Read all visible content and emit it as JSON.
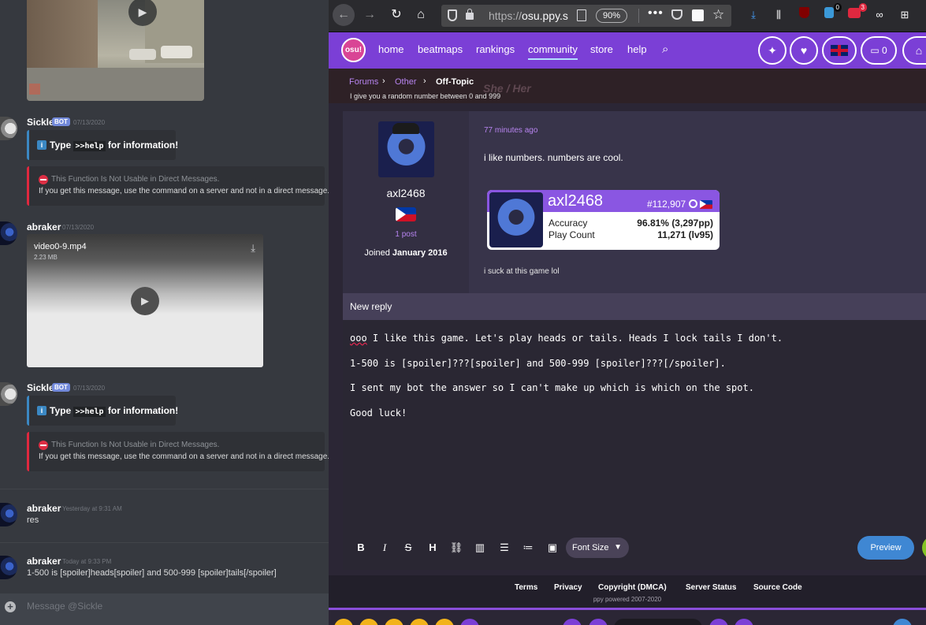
{
  "discord": {
    "messages": [
      {
        "author": "Sickle",
        "bot_tag": "BOT",
        "time": "07/13/2020",
        "embed_help": {
          "prefix": "Type ",
          "command": ">>help",
          "suffix": " for information!"
        },
        "embed_error": {
          "title": "This Function Is Not Usable in Direct Messages.",
          "description": "If you get this message, use the command on a server and not in a direct message."
        }
      },
      {
        "author": "abraker",
        "time": "07/13/2020",
        "attachment": {
          "filename": "video0-9.mp4",
          "size": "2.23 MB"
        }
      },
      {
        "author": "Sickle",
        "bot_tag": "BOT",
        "time": "07/13/2020",
        "embed_help": {
          "prefix": "Type ",
          "command": ">>help",
          "suffix": " for information!"
        },
        "embed_error": {
          "title": "This Function Is Not Usable in Direct Messages.",
          "description": "If you get this message, use the command on a server and not in a direct message."
        }
      },
      {
        "author": "abraker",
        "time": "Yesterday at 9:31 AM",
        "text": "res"
      },
      {
        "author": "abraker",
        "time": "Today at 9:33 PM",
        "text": "1-500 is [spoiler]heads[spoiler] and 500-999 [spoiler]tails[/spoiler]"
      }
    ],
    "input_placeholder": "Message @Sickle"
  },
  "browser": {
    "url_prefix": "https://",
    "url_host": "osu.ppy.s",
    "zoom": "90%",
    "badges": {
      "ext_blue": "0",
      "ext_red": "3"
    }
  },
  "osu_nav": {
    "logo": "osu!",
    "items": [
      "home",
      "beatmaps",
      "rankings",
      "community",
      "store",
      "help"
    ],
    "active": "community",
    "chat_count": "0"
  },
  "breadcrumb": {
    "items": [
      "Forums",
      "Other",
      "Off-Topic"
    ],
    "subtitle": "I give you a random number between 0 and 999",
    "ghost_text": "She / Her"
  },
  "post": {
    "username": "axl2468",
    "post_count": "1 post",
    "joined_label": "Joined ",
    "joined_date": "January 2016",
    "time_ago": "77 minutes ago",
    "body": "i like numbers. numbers are cool.",
    "signature": "i suck at this game lol",
    "card": {
      "name": "axl2468",
      "rank": "#112,907",
      "accuracy_label": "Accuracy",
      "accuracy_value": "96.81% (3,297pp)",
      "playcount_label": "Play Count",
      "playcount_value": "11,271 (lv95)"
    }
  },
  "reply": {
    "title": "New reply",
    "lines": [
      {
        "pre": "",
        "spell": "ooo",
        "post": " I like this game. Let's play heads or tails. Heads I lock tails I don't."
      },
      {
        "pre": "1-500 is [spoiler]???[spoiler] and 500-999 [spoiler]???[/spoiler].",
        "spell": "",
        "post": ""
      },
      {
        "pre": "I sent my bot the answer so I can't make up which is which on the spot.",
        "spell": "",
        "post": ""
      },
      {
        "pre": "Good luck!",
        "spell": "",
        "post": ""
      }
    ],
    "font_size_label": "Font Size",
    "preview_label": "Preview"
  },
  "footer": {
    "links": [
      "Terms",
      "Privacy",
      "Copyright (DMCA)",
      "Server Status",
      "Source Code"
    ],
    "copyright": "ppy powered 2007-2020"
  },
  "colors": {
    "osu_purple": "#7b3fd6",
    "link_purple": "#b784f0",
    "discord_bg": "#36393f",
    "embed_blue": "#3b88c3",
    "embed_red": "#e0283f"
  }
}
